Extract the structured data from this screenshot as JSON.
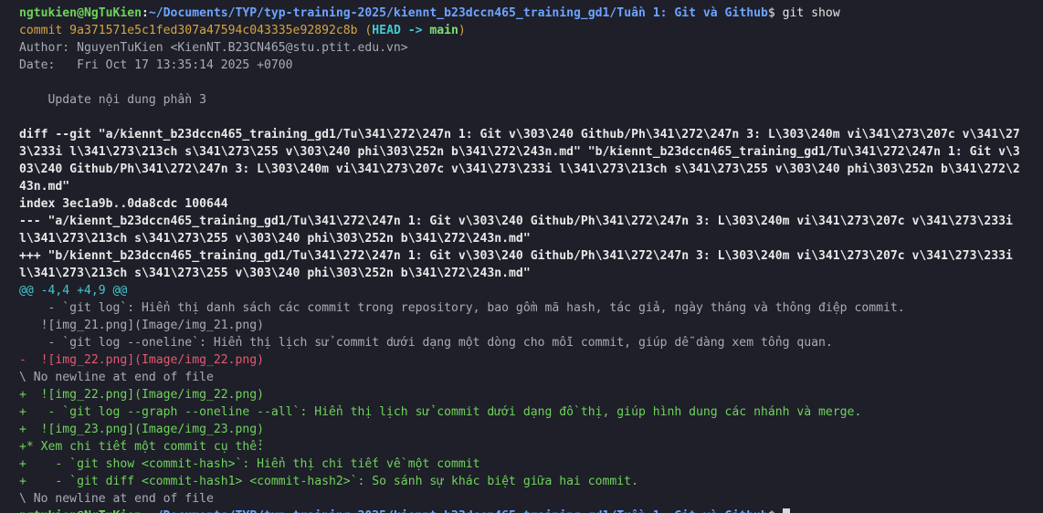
{
  "prompt": {
    "user_host": "ngtukien@NgTuKien",
    "separator": ":",
    "path": "~/Documents/TYP/typ-training-2025/kiennt_b23dccn465_training_gd1/Tuần 1: Git và Github",
    "symbol": "$",
    "command": " git show"
  },
  "commit": {
    "line": "commit 9a371571e5c1fed307a47594c043335e92892c8b",
    "refs_open": " (",
    "head": "HEAD -> ",
    "branch": "main",
    "refs_close": ")",
    "author": "Author: NguyenTuKien <KienNT.B23CN465@stu.ptit.edu.vn>",
    "date": "Date:   Fri Oct 17 13:35:14 2025 +0700",
    "message": "    Update nội dung phần 3"
  },
  "diff": {
    "header_lines": [
      "diff --git \"a/kiennt_b23dccn465_training_gd1/Tu\\341\\272\\247n 1: Git v\\303\\240 Github/Ph\\341\\272\\247n 3: L\\303\\240m vi\\341\\273\\207c v\\341\\27",
      "3\\233i l\\341\\273\\213ch s\\341\\273\\255 v\\303\\240 phi\\303\\252n b\\341\\272\\243n.md\" \"b/kiennt_b23dccn465_training_gd1/Tu\\341\\272\\247n 1: Git v\\3",
      "03\\240 Github/Ph\\341\\272\\247n 3: L\\303\\240m vi\\341\\273\\207c v\\341\\273\\233i l\\341\\273\\213ch s\\341\\273\\255 v\\303\\240 phi\\303\\252n b\\341\\272\\2",
      "43n.md\"",
      "index 3ec1a9b..0da8cdc 100644",
      "--- \"a/kiennt_b23dccn465_training_gd1/Tu\\341\\272\\247n 1: Git v\\303\\240 Github/Ph\\341\\272\\247n 3: L\\303\\240m vi\\341\\273\\207c v\\341\\273\\233i",
      "l\\341\\273\\213ch s\\341\\273\\255 v\\303\\240 phi\\303\\252n b\\341\\272\\243n.md\"",
      "+++ \"b/kiennt_b23dccn465_training_gd1/Tu\\341\\272\\247n 1: Git v\\303\\240 Github/Ph\\341\\272\\247n 3: L\\303\\240m vi\\341\\273\\207c v\\341\\273\\233i",
      "l\\341\\273\\213ch s\\341\\273\\255 v\\303\\240 phi\\303\\252n b\\341\\272\\243n.md\""
    ],
    "hunk": "@@ -4,4 +4,9 @@",
    "lines": [
      {
        "kind": "context",
        "text": "    - `git log`: Hiển thị danh sách các commit trong repository, bao gồm mã hash, tác giả, ngày tháng và thông điệp commit."
      },
      {
        "kind": "context",
        "text": "   ![img_21.png](Image/img_21.png)"
      },
      {
        "kind": "context",
        "text": "    - `git log --oneline`: Hiển thị lịch sử commit dưới dạng một dòng cho mỗi commit, giúp dễ dàng xem tổng quan."
      },
      {
        "kind": "removed",
        "text": "-  ![img_22.png](Image/img_22.png)"
      },
      {
        "kind": "context",
        "text": "\\ No newline at end of file"
      },
      {
        "kind": "added",
        "text": "+  ![img_22.png](Image/img_22.png)"
      },
      {
        "kind": "added",
        "text": "+   - `git log --graph --oneline --all`: Hiển thị lịch sử commit dưới dạng đồ thị, giúp hình dung các nhánh và merge."
      },
      {
        "kind": "added",
        "text": "+  ![img_23.png](Image/img_23.png)"
      },
      {
        "kind": "added",
        "text": "+* Xem chi tiết một commit cụ thể:"
      },
      {
        "kind": "added",
        "text": "+    - `git show <commit-hash>`: Hiển thị chi tiết về một commit"
      },
      {
        "kind": "added",
        "text": "+    - `git diff <commit-hash1> <commit-hash2>`: So sánh sự khác biệt giữa hai commit."
      },
      {
        "kind": "context",
        "text": "\\ No newline at end of file"
      }
    ]
  },
  "colors": {
    "background": "#1e1f29",
    "user_host": "#6fd35a",
    "path": "#6ea4ff",
    "commit_hash": "#d7a53c",
    "head_ref": "#43c8cf",
    "branch": "#7fe06f",
    "removed": "#e45a6f",
    "added": "#6fd35a",
    "hunk": "#43c8cf"
  }
}
